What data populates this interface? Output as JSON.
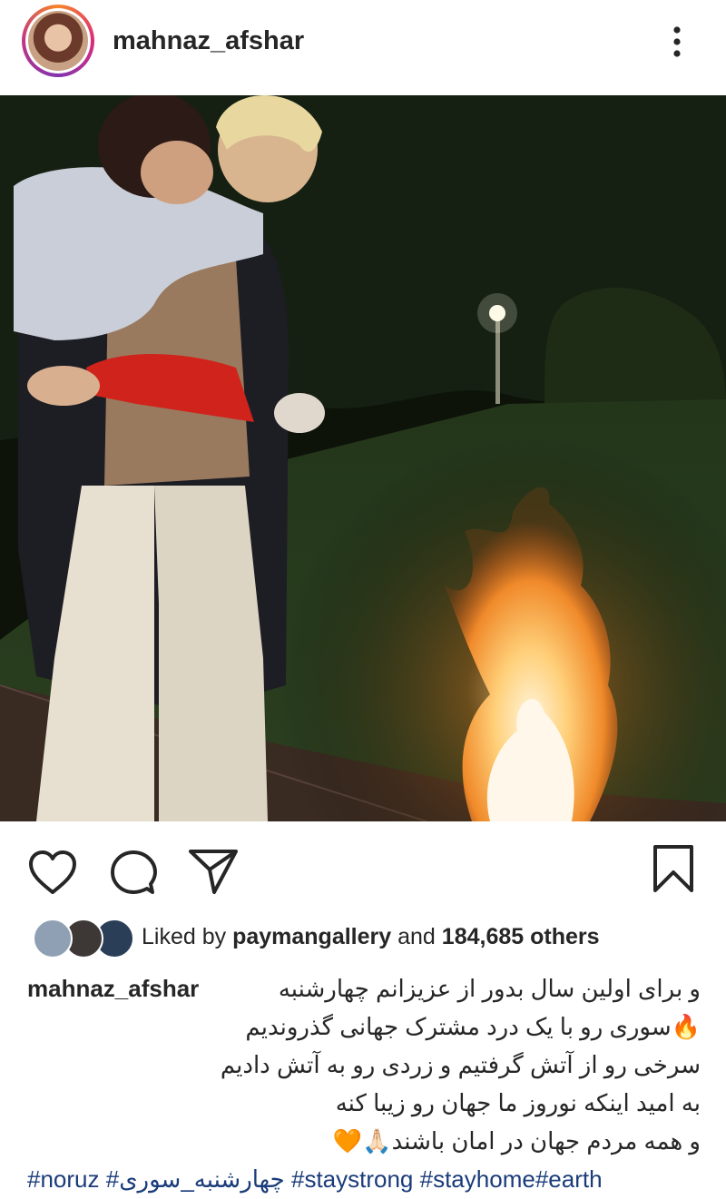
{
  "header": {
    "username": "mahnaz_afshar",
    "more_icon": "more-vertical-icon"
  },
  "post": {
    "image_alt": "Woman holding a child beside a night fire in a garden",
    "actions": {
      "like_icon": "heart-icon",
      "comment_icon": "comment-icon",
      "share_icon": "send-icon",
      "save_icon": "bookmark-icon"
    },
    "likes": {
      "prefix": "Liked by",
      "liker": "paymangallery",
      "middle": "and",
      "count": "184,685 others"
    },
    "caption": {
      "username": "mahnaz_afshar",
      "lines": [
        "و برای اولین سال بدور از عزیزانم چهارشنبه",
        "🔥سوری رو با یک درد مشترک جهانی گذروندیم",
        "سرخی رو از آتش گرفتیم و زردی رو به آتش دادیم",
        "به امید اینکه نوروز ما جهان رو زیبا کنه",
        "و همه مردم جهان در امان باشند🙏🏻🧡"
      ],
      "hashtags": [
        "#noruz",
        "#چهارشنبه_سوری",
        "#staystrong",
        "#stayhome",
        "#earth"
      ]
    }
  },
  "colors": {
    "text": "#262626",
    "hashtag": "#1a3c7a",
    "ring_start": "#f58529",
    "ring_end": "#8134af"
  }
}
